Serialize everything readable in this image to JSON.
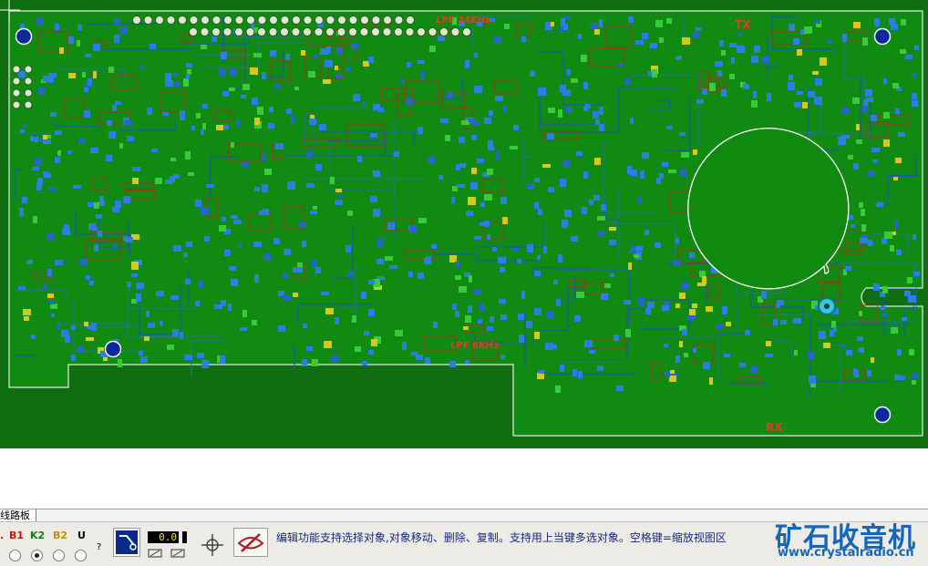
{
  "board": {
    "net_labels": [
      "LPF 24KHz",
      "LPF 8KHz",
      "TX",
      "RX"
    ]
  },
  "tabs": {
    "pcb": "线路板"
  },
  "toolbar": {
    "layers": [
      {
        "label": "B1",
        "color": "#d01010"
      },
      {
        "label": "K2",
        "color": "#108010"
      },
      {
        "label": "B2",
        "color": "#c09000"
      },
      {
        "label": "U",
        "color": "#000000"
      }
    ],
    "help": "?",
    "coord": "0.0",
    "status": "编辑功能支持选择对象,对象移动、删除、复制。支持用上当键多选对象。空格键=缩放视图区"
  },
  "logo": {
    "name": "矿石收音机",
    "url": "www.crystalradio.cn"
  }
}
